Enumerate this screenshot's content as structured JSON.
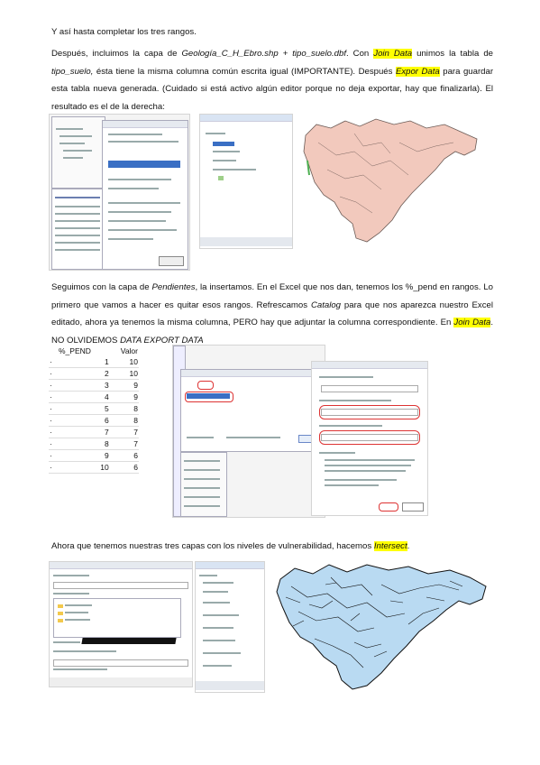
{
  "paragraphs": {
    "p1": "Y así hasta completar los tres rangos.",
    "p2": {
      "a": "Después, incluimos la capa de ",
      "b": "Geología_C_H_Ebro.shp + tipo_suelo.dbf",
      "c": ". Con ",
      "d": "Join Data",
      "e": " unimos la tabla de ",
      "f": "tipo_suelo,",
      "g": " ésta tiene la misma columna común escrita igual (IMPORTANTE). Después ",
      "h": "Expor Data",
      "i": " para guardar esta tabla nueva generada. (Cuidado si está activo algún editor porque no deja exportar, hay que finalizarla). El resultado es el de la derecha:"
    },
    "p3": {
      "a": "Seguimos con la capa de ",
      "b": "Pendientes",
      "c": ", la insertamos. En el Excel que nos dan, tenemos los %_pend en rangos. Lo primero que vamos a hacer es quitar esos rangos. Refrescamos ",
      "d": "Catalog",
      "e": " para que nos aparezca nuestro Excel editado, ahora ya tenemos la misma columna, PERO hay que adjuntar la columna correspondiente. En ",
      "f": "Join Data",
      "g": ". NO OLVIDEMOS ",
      "h": "DATA EXPORT DATA"
    },
    "p4": {
      "a": "Ahora que tenemos nuestras tres capas con los niveles de vulnerabilidad, hacemos ",
      "b": "Intersect",
      "c": "."
    }
  },
  "excel_table": {
    "headers": [
      "%_PEND",
      "Valor"
    ],
    "rows": [
      [
        "1",
        "10"
      ],
      [
        "2",
        "10"
      ],
      [
        "3",
        "9"
      ],
      [
        "4",
        "9"
      ],
      [
        "5",
        "8"
      ],
      [
        "6",
        "8"
      ],
      [
        "7",
        "7"
      ],
      [
        "8",
        "7"
      ],
      [
        "9",
        "6"
      ],
      [
        "10",
        "6"
      ]
    ]
  },
  "colors": {
    "highlight": "#ffff00",
    "map_pink": "#f2c9bd",
    "map_blue": "#b9daf2"
  }
}
